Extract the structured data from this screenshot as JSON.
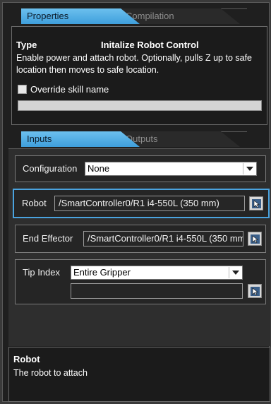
{
  "tabs_top": [
    {
      "label": "Properties",
      "active": true
    },
    {
      "label": "Compilation",
      "active": false
    }
  ],
  "properties": {
    "type_label": "Type",
    "type_value": "Initalize Robot Control",
    "description": "Enable power and attach robot. Optionally, pulls Z up to safe location then moves to safe location.",
    "override_label": "Override skill name",
    "override_checked": false,
    "skill_name_value": ""
  },
  "tabs_bottom": [
    {
      "label": "Inputs",
      "active": true
    },
    {
      "label": "Outputs",
      "active": false
    }
  ],
  "inputs": {
    "configuration": {
      "label": "Configuration",
      "value": "None"
    },
    "robot": {
      "label": "Robot",
      "value": "/SmartController0/R1 i4-550L (350 mm)"
    },
    "end_effector": {
      "label": "End Effector",
      "value": "/SmartController0/R1 i4-550L (350 mm"
    },
    "tip_index": {
      "label": "Tip Index",
      "value": "Entire Gripper",
      "extra_value": ""
    }
  },
  "help": {
    "title": "Robot",
    "text": "The robot to attach"
  },
  "colors": {
    "accent": "#4aa3df",
    "background": "#1f1f1f"
  }
}
